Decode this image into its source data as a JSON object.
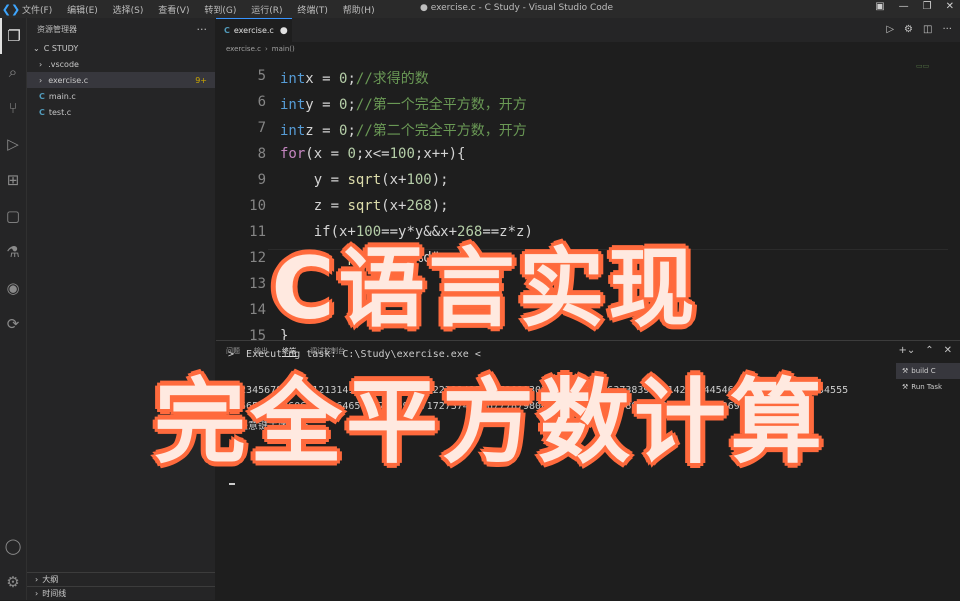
{
  "titlebar": {
    "menu": [
      "文件(F)",
      "编辑(E)",
      "选择(S)",
      "查看(V)",
      "转到(G)",
      "运行(R)",
      "终端(T)",
      "帮助(H)"
    ],
    "title": "● exercise.c - C Study - Visual Studio Code"
  },
  "sidebar": {
    "header": "资源管理器",
    "root": "C STUDY",
    "items": [
      {
        "label": ".vscode",
        "kind": "folder"
      },
      {
        "label": "exercise.c",
        "kind": "c",
        "badge": "9+"
      },
      {
        "label": "main.c",
        "kind": "c"
      },
      {
        "label": "test.c",
        "kind": "c"
      }
    ],
    "outline": "大纲",
    "timeline": "时间线"
  },
  "tab": {
    "label": "exercise.c",
    "icon": "C"
  },
  "breadcrumb": [
    "exercise.c",
    "main()"
  ],
  "editor": {
    "line_numbers": [
      "5",
      "6",
      "7",
      "8",
      "9",
      "10",
      "11",
      "12",
      "13",
      "14",
      "15"
    ],
    "lines": [
      {
        "t": [
          [
            "kw",
            "int"
          ],
          [
            "",
            "x = "
          ],
          [
            "num",
            "0"
          ],
          [
            "",
            ";"
          ],
          [
            "cm",
            "//求得的数"
          ]
        ]
      },
      {
        "t": [
          [
            "kw",
            "int"
          ],
          [
            "",
            "y = "
          ],
          [
            "num",
            "0"
          ],
          [
            "",
            ";"
          ],
          [
            "cm",
            "//第一个完全平方数，开方"
          ]
        ]
      },
      {
        "t": [
          [
            "kw",
            "int"
          ],
          [
            "",
            "z = "
          ],
          [
            "num",
            "0"
          ],
          [
            "",
            ";"
          ],
          [
            "cm",
            "//第二个完全平方数，开方"
          ]
        ]
      },
      {
        "t": [
          [
            "ctl",
            "for"
          ],
          [
            "",
            "(x = "
          ],
          [
            "num",
            "0"
          ],
          [
            "",
            ";x<="
          ],
          [
            "num",
            "100"
          ],
          [
            "",
            ";x++){"
          ]
        ]
      },
      {
        "t": [
          [
            "",
            "    y = "
          ],
          [
            "fn",
            "sqrt"
          ],
          [
            "",
            "(x+"
          ],
          [
            "num",
            "100"
          ],
          [
            "",
            ");"
          ]
        ]
      },
      {
        "t": [
          [
            "",
            "    z = "
          ],
          [
            "fn",
            "sqrt"
          ],
          [
            "",
            "(x+"
          ],
          [
            "num",
            "268"
          ],
          [
            "",
            ");"
          ]
        ]
      },
      {
        "t": [
          [
            "",
            "    if(x+"
          ],
          [
            "num",
            "100"
          ],
          [
            "",
            "==y*y&&x+"
          ],
          [
            "num",
            "268"
          ],
          [
            "",
            "==z*z)"
          ]
        ]
      },
      {
        "t": [
          [
            "",
            "        "
          ],
          [
            "fn",
            "printf"
          ],
          [
            "",
            "(\"%d\",x);"
          ]
        ]
      },
      {
        "t": [
          [
            "",
            ""
          ]
        ]
      },
      {
        "t": [
          [
            "",
            "    }"
          ]
        ]
      },
      {
        "t": [
          [
            "",
            "}"
          ]
        ]
      }
    ]
  },
  "panel": {
    "tabs": [
      "问题",
      "输出",
      "终端",
      "调试控制台"
    ],
    "active_tab": "终端",
    "terminal_lines": [
      ">  Executing task: C:\\Study\\exercise.exe < ",
      "",
      "0123456789101112131415161718192021222324252627282930313233343536373839404142434445464748495051525354555",
      "4556575859606162636465666768697071727374757677787980818283848586878889909192939495969798",
      "按任意键关闭终端。"
    ],
    "tasks": [
      "build C",
      "Run Task"
    ]
  },
  "overlay": {
    "line1": "C语言实现",
    "line2": "完全平方数计算"
  }
}
